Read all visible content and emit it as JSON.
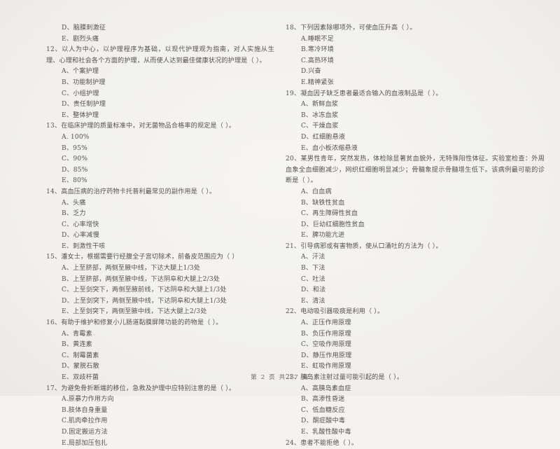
{
  "document": {
    "type": "scanned-exam-page",
    "language": "zh-CN",
    "ink_color": "#56534f",
    "paper_color": "#f4f3f0"
  },
  "footer": {
    "page_label": "第 2 页 共 17 页"
  },
  "left_column": {
    "carryover_options": [
      "D、脑膜刺激征",
      "E、剧烈头痛"
    ],
    "questions": [
      {
        "number": "12",
        "stem": "12、以人为中心，以护理程序为基础，以现代护理观为指南，对人实施从生理、心理和社会各个方面的护理，从而使人达到最佳健康状况的护理是（      ）。",
        "options": [
          "A、个案护理",
          "B、功能制护理",
          "C、小组护理",
          "D、责任制护理",
          "E、整体护理"
        ]
      },
      {
        "number": "13",
        "stem": "13、在临床护理的质量标准中，对无菌物品合格率的规定是（      ）。",
        "options": [
          "A. 100%",
          "B、95%",
          "C、90%",
          "D、85%",
          "E、80%"
        ]
      },
      {
        "number": "14",
        "stem": "14、高血压病的治疗药物卡托普利最常见的副作用是（      ）。",
        "options": [
          "A、头痛",
          "B、乏力",
          "C、心率增快",
          "D、心率减慢",
          "E、刺激性干咳"
        ]
      },
      {
        "number": "15",
        "stem": "15、潘女士，根据需要行经腹全子宫切除术，前备皮范围应为（      ）",
        "options": [
          "A、上至脐部，两侧至腋中线，下达大腿上1/3处",
          "B、上至脐部，两侧至腋中线，下达阴阜和大腿上2/3处",
          "C、上至剑突下，两侧至腋前线，下达阴阜和大腿上1/3处",
          "D、上至剑突下，两侧至腋中线，下达阴阜和大腿上1/3处",
          "E、上至剑突下，两侧至腋中线，下达大腿上2/3处"
        ]
      },
      {
        "number": "16",
        "stem": "16、有助于维护和修复小儿肠道黏膜屏障功能的药物是（      ）。",
        "options": [
          "A、青霉素",
          "B、黄连素",
          "C、制霉菌素",
          "D、蒙脱石散",
          "E、双歧杆菌"
        ]
      },
      {
        "number": "17",
        "stem": "17、为避免骨折断端的移位，急救及护理中应特别注意的是（      ）。",
        "options": [
          "A.原暴力作用方向",
          "B.肢体自身重量",
          "C.肌肉牵拉作用",
          "D.固定搬运方法",
          "E.局部加压包扎"
        ]
      }
    ]
  },
  "right_column": {
    "questions": [
      {
        "number": "18",
        "stem": "18、下列因素除哪项外，可使血压升高（      ）。",
        "options": [
          "A.睡眠不足",
          "B.寒冷环境",
          "C.高热环境",
          "D.兴奋",
          "E.精神紧张"
        ]
      },
      {
        "number": "19",
        "stem": "19、凝血因子缺乏患者最适合输入的血液制品是（      ）。",
        "options": [
          "A、新鲜血浆",
          "B、冰冻血浆",
          "C、干燥血浆",
          "D、红细胞悬液",
          "E、血小板浓缩悬液"
        ]
      },
      {
        "number": "20",
        "stem": "20、某男性青年，突然发热，体检除显著贫血貌外，无特殊阳性体征。实验室检查：外周血象全血细胞减少，网织红细胞明显减少；骨髓象提示骨髓增生低下。该病例最可能的诊断是（      ）。",
        "options": [
          "A、白血病",
          "B、缺铁性贫血",
          "C、再生障碍性贫血",
          "D、巨幼红细胞性贫血",
          "E、脾功能亢进"
        ]
      },
      {
        "number": "21",
        "stem": "21、引导病邪或有害物质，使从口涌吐的方法为（      ）。",
        "options": [
          "A、汗法",
          "B、下法",
          "C、吐法",
          "D、和法",
          "E、清法"
        ]
      },
      {
        "number": "22",
        "stem": "22、电动吸引器吸痰是利用（      ）。",
        "options": [
          "A、正压作用原理",
          "B、负压作用原理",
          "C、空吸作用原理",
          "D、静压作用原理",
          "E、虹吸作用原理"
        ]
      },
      {
        "number": "23",
        "stem": "23、胰岛素注射过量可能引起的是（      ）。",
        "options": [
          "A、高胰岛素血症",
          "B、高渗性昏迷",
          "C、低血糖反应",
          "D、酮症酸中毒",
          "E、乳酸性酸中毒"
        ]
      },
      {
        "number": "24",
        "stem": "24、患者不能拒绝（      ）。",
        "options": []
      }
    ]
  }
}
